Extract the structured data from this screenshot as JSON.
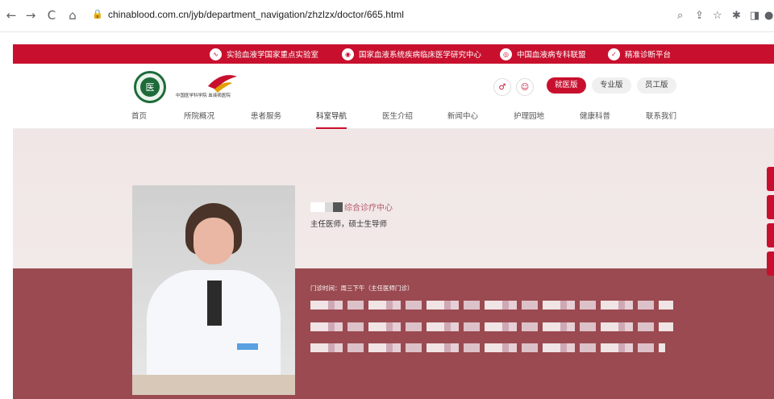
{
  "browser": {
    "url": "chinablood.com.cn/jyb/department_navigation/zhzlzx/doctor/665.html",
    "back_icon": "←",
    "forward_icon": "→",
    "reload_icon": "C",
    "home_icon": "⌂",
    "lock_icon": "🔒"
  },
  "topbar": {
    "links": [
      "实验血液学国家重点实验室",
      "国家血液系统疾病临床医学研究中心",
      "中国血液病专科联盟",
      "精准诊断平台"
    ],
    "color": "#c8102e"
  },
  "header": {
    "emblem_glyph": "医",
    "logo_text": "中国医学科学院 血液病医院",
    "versions": [
      "就医版",
      "专业版",
      "员工版"
    ]
  },
  "nav": {
    "items": [
      "首页",
      "所院概况",
      "患者服务",
      "科室导航",
      "医生介绍",
      "新闻中心",
      "护理园地",
      "健康科普",
      "联系我们"
    ],
    "active": "科室导航"
  },
  "doctor": {
    "department": "综合诊疗中心",
    "title": "主任医师，硕士生导师",
    "clinic_time": "门诊时间：周三下午（主任医师门诊）"
  },
  "colors": {
    "accent": "#c8102e",
    "band": "#9a4a50",
    "hero": "#f0e6e6"
  }
}
